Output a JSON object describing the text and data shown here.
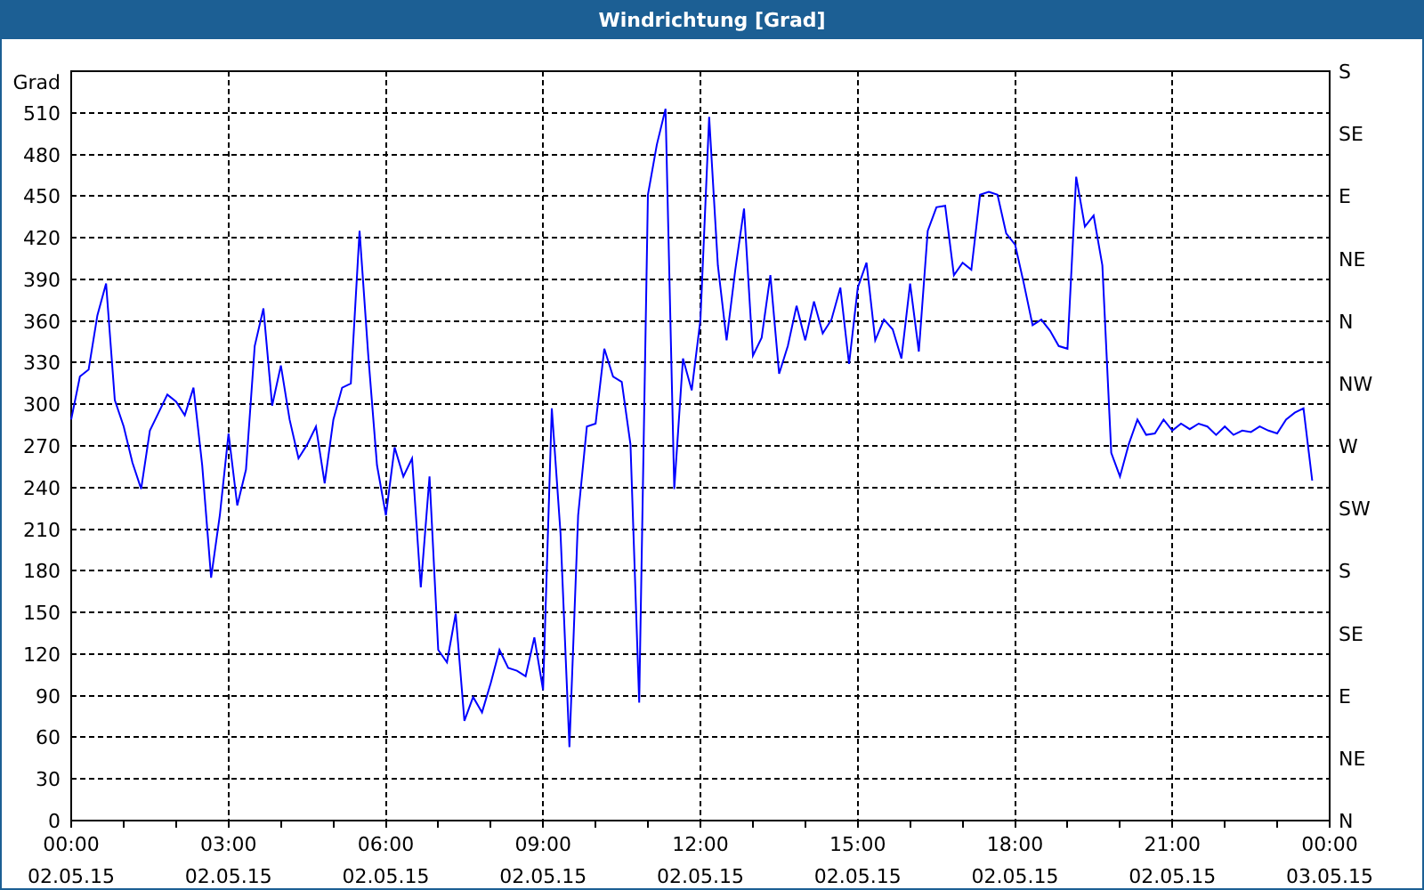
{
  "window": {
    "title": "Windrichtung [Grad]"
  },
  "chart": {
    "right_axis_labels": [
      "S",
      "SE",
      "E",
      "NE",
      "N",
      "NW",
      "W",
      "SW",
      "S",
      "SE",
      "E",
      "NE",
      "N"
    ],
    "chart_data": {
      "type": "line",
      "grid": true,
      "ylabel": "Grad",
      "ylim": [
        0,
        540
      ],
      "categories": [
        "00:00 02.05.15",
        null,
        null,
        null,
        null,
        null,
        null,
        null,
        null,
        null,
        null,
        null,
        null,
        null,
        null,
        null,
        null,
        null,
        "03:00 02.05.15",
        null,
        null,
        null,
        null,
        null,
        null,
        null,
        null,
        null,
        null,
        null,
        null,
        null,
        null,
        null,
        null,
        null,
        "06:00 02.05.15",
        null,
        null,
        null,
        null,
        null,
        null,
        null,
        null,
        null,
        null,
        null,
        null,
        null,
        null,
        null,
        null,
        null,
        "09:00 02.05.15",
        null,
        null,
        null,
        null,
        null,
        null,
        null,
        null,
        null,
        null,
        null,
        null,
        null,
        null,
        null,
        null,
        null,
        "12:00 02.05.15",
        null,
        null,
        null,
        null,
        null,
        null,
        null,
        null,
        null,
        null,
        null,
        null,
        null,
        null,
        null,
        null,
        null,
        "15:00 02.05.15",
        null,
        null,
        null,
        null,
        null,
        null,
        null,
        null,
        null,
        null,
        null,
        null,
        null,
        null,
        null,
        null,
        null,
        "18:00 02.05.15",
        null,
        null,
        null,
        null,
        null,
        null,
        null,
        null,
        null,
        null,
        null,
        null,
        null,
        null,
        null,
        null,
        null,
        "21:00 02.05.15",
        null,
        null,
        null,
        null,
        null,
        null,
        null,
        null,
        null,
        null,
        null,
        null,
        null,
        null,
        null,
        null,
        null,
        "00:00 03.05.15"
      ],
      "yticks": [
        0,
        30,
        60,
        90,
        120,
        150,
        180,
        210,
        240,
        270,
        300,
        330,
        360,
        390,
        420,
        450,
        480,
        510
      ],
      "series": [
        {
          "color": "#0000ff",
          "values": [
            289,
            320,
            325,
            364,
            387,
            303,
            284,
            258,
            239,
            281,
            294,
            307,
            302,
            292,
            312,
            256,
            175,
            220,
            279,
            227,
            253,
            342,
            369,
            299,
            328,
            289,
            261,
            271,
            284,
            243,
            289,
            312,
            315,
            425,
            335,
            256,
            220,
            269,
            248,
            261,
            168,
            248,
            123,
            114,
            149,
            72,
            89,
            78,
            99,
            123,
            110,
            108,
            104,
            132,
            94,
            297,
            207,
            53,
            220,
            284,
            286,
            340,
            320,
            316,
            271,
            85,
            451,
            487,
            513,
            239,
            333,
            310,
            361,
            507,
            400,
            346,
            397,
            441,
            335,
            348,
            393,
            322,
            342,
            371,
            346,
            374,
            351,
            361,
            384,
            329,
            384,
            402,
            346,
            361,
            354,
            333,
            387,
            338,
            425,
            442,
            443,
            393,
            402,
            397,
            451,
            453,
            451,
            423,
            415,
            387,
            357,
            361,
            353,
            342,
            340,
            464,
            428,
            436,
            400,
            265,
            248,
            271,
            289,
            278,
            279,
            289,
            281,
            286,
            282,
            286,
            284,
            278,
            284,
            278,
            281,
            280,
            284,
            281,
            279,
            289,
            294,
            297,
            245,
            null,
            null
          ]
        }
      ]
    }
  }
}
